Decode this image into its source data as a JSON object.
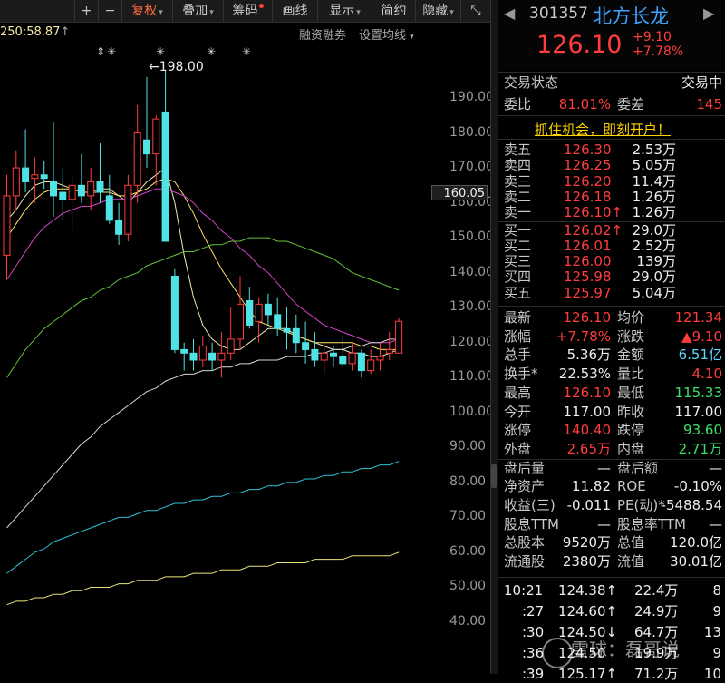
{
  "toolbar": {
    "buttons": [
      {
        "label": "+"
      },
      {
        "label": "−"
      },
      {
        "label": "复权",
        "caret": "▾",
        "active": true
      },
      {
        "label": "叠加",
        "caret": "▾"
      },
      {
        "label": "筹码"
      },
      {
        "label": "画线"
      },
      {
        "label": "显示",
        "caret": "▾"
      },
      {
        "label": "简约"
      },
      {
        "label": "隐藏",
        "caret": "▾"
      },
      {
        "label": "⤡"
      }
    ]
  },
  "subbar": {
    "ma250": "250:58.87",
    "ma250_arrow": "↑",
    "rzrq": "融资融券",
    "setma": "设置均线",
    "caret": "▾"
  },
  "y_axis": {
    "ticks": [
      "190.00",
      "180.00",
      "170.00",
      "160.00",
      "150.00",
      "140.00",
      "130.00",
      "120.00",
      "110.00",
      "100.00",
      "90.00",
      "80.00",
      "70.00",
      "60.00",
      "50.00",
      "40.00"
    ],
    "current": "160.05"
  },
  "high_label": "198.00",
  "event_markers": [
    "⇕",
    "✳",
    "✳",
    "✳",
    "✳",
    "⇕"
  ],
  "chart_data": {
    "type": "candlestick",
    "ylim": [
      35,
      200
    ],
    "candles": [
      {
        "o": 145,
        "h": 168,
        "l": 138,
        "c": 162
      },
      {
        "o": 162,
        "h": 175,
        "l": 158,
        "c": 170
      },
      {
        "o": 170,
        "h": 181,
        "l": 163,
        "c": 166
      },
      {
        "o": 167,
        "h": 173,
        "l": 160,
        "c": 168
      },
      {
        "o": 168,
        "h": 172,
        "l": 164,
        "c": 167
      },
      {
        "o": 166,
        "h": 183,
        "l": 156,
        "c": 162
      },
      {
        "o": 163,
        "h": 170,
        "l": 155,
        "c": 161
      },
      {
        "o": 161,
        "h": 168,
        "l": 152,
        "c": 165
      },
      {
        "o": 165,
        "h": 174,
        "l": 160,
        "c": 162
      },
      {
        "o": 162,
        "h": 170,
        "l": 158,
        "c": 166
      },
      {
        "o": 166,
        "h": 177,
        "l": 160,
        "c": 163
      },
      {
        "o": 162,
        "h": 168,
        "l": 154,
        "c": 155
      },
      {
        "o": 155,
        "h": 160,
        "l": 148,
        "c": 151
      },
      {
        "o": 151,
        "h": 168,
        "l": 149,
        "c": 165
      },
      {
        "o": 165,
        "h": 188,
        "l": 160,
        "c": 180
      },
      {
        "o": 178,
        "h": 196,
        "l": 170,
        "c": 174
      },
      {
        "o": 174,
        "h": 185,
        "l": 165,
        "c": 184
      },
      {
        "o": 186,
        "h": 198,
        "l": 149,
        "c": 149
      },
      {
        "o": 139,
        "h": 141,
        "l": 117,
        "c": 118
      },
      {
        "o": 118,
        "h": 120,
        "l": 112,
        "c": 117
      },
      {
        "o": 117,
        "h": 121,
        "l": 112,
        "c": 115
      },
      {
        "o": 115,
        "h": 122,
        "l": 113,
        "c": 119
      },
      {
        "o": 117,
        "h": 120,
        "l": 112,
        "c": 115
      },
      {
        "o": 115,
        "h": 123,
        "l": 110,
        "c": 117
      },
      {
        "o": 117,
        "h": 130,
        "l": 115,
        "c": 121
      },
      {
        "o": 121,
        "h": 139,
        "l": 118,
        "c": 131
      },
      {
        "o": 132,
        "h": 136,
        "l": 124,
        "c": 125
      },
      {
        "o": 126,
        "h": 133,
        "l": 120,
        "c": 131
      },
      {
        "o": 131,
        "h": 134,
        "l": 125,
        "c": 128
      },
      {
        "o": 128,
        "h": 133,
        "l": 122,
        "c": 124
      },
      {
        "o": 124,
        "h": 130,
        "l": 118,
        "c": 123
      },
      {
        "o": 124,
        "h": 128,
        "l": 117,
        "c": 120
      },
      {
        "o": 120,
        "h": 126,
        "l": 114,
        "c": 118
      },
      {
        "o": 118,
        "h": 123,
        "l": 113,
        "c": 115
      },
      {
        "o": 115,
        "h": 120,
        "l": 111,
        "c": 117
      },
      {
        "o": 117,
        "h": 119,
        "l": 113,
        "c": 116
      },
      {
        "o": 116,
        "h": 122,
        "l": 113,
        "c": 114
      },
      {
        "o": 114,
        "h": 120,
        "l": 112,
        "c": 117
      },
      {
        "o": 117,
        "h": 118,
        "l": 110,
        "c": 112
      },
      {
        "o": 112,
        "h": 118,
        "l": 111,
        "c": 115
      },
      {
        "o": 115,
        "h": 120,
        "l": 112,
        "c": 116
      },
      {
        "o": 117,
        "h": 123,
        "l": 115,
        "c": 118
      },
      {
        "o": 117,
        "h": 127,
        "l": 117,
        "c": 126.1
      }
    ],
    "ma_lines": [
      {
        "color": "#f1e9b3",
        "values": [
          155,
          158,
          162,
          165,
          166,
          166,
          165,
          164,
          163,
          163,
          164,
          164,
          162,
          160,
          163,
          166,
          168,
          170,
          160,
          145,
          133,
          125,
          121,
          119,
          118,
          118,
          120,
          122,
          124,
          124,
          124,
          122,
          121,
          120,
          119,
          118,
          118,
          117,
          117,
          116,
          116,
          117,
          118
        ]
      },
      {
        "color": "#ffe36a",
        "values": [
          150,
          154,
          158,
          161,
          163,
          164,
          164,
          164,
          163,
          163,
          163,
          163,
          162,
          162,
          163,
          164,
          166,
          167,
          166,
          162,
          157,
          151,
          146,
          141,
          137,
          133,
          129,
          126,
          125,
          124,
          123,
          122,
          121,
          120,
          120,
          120,
          120,
          120,
          119,
          119,
          118,
          118,
          118
        ]
      },
      {
        "color": "#d444c8",
        "values": [
          138,
          142,
          146,
          150,
          153,
          155,
          157,
          158,
          159,
          159,
          160,
          161,
          161,
          161,
          162,
          163,
          164,
          164,
          163,
          162,
          160,
          157,
          155,
          152,
          150,
          147,
          145,
          142,
          140,
          137,
          134,
          131,
          129,
          127,
          125,
          124,
          123,
          122,
          121,
          120,
          120,
          120,
          121
        ]
      },
      {
        "color": "#63c23c",
        "values": [
          110,
          114,
          118,
          121,
          124,
          126,
          128,
          130,
          132,
          133,
          135,
          136,
          138,
          139,
          140,
          142,
          143,
          144,
          145,
          146,
          146,
          147,
          148,
          148,
          149,
          149,
          150,
          150,
          150,
          149,
          149,
          148,
          147,
          146,
          145,
          144,
          142,
          140,
          139,
          138,
          137,
          136,
          135
        ]
      },
      {
        "color": "#d7d7d7",
        "values": [
          67,
          70,
          73,
          76,
          79,
          82,
          85,
          88,
          91,
          93,
          96,
          98,
          100,
          102,
          104,
          106,
          107,
          109,
          110,
          111,
          111,
          112,
          112,
          113,
          113,
          114,
          114,
          115,
          115,
          115,
          116,
          116,
          116,
          117,
          117,
          118,
          118,
          119,
          119,
          120,
          120,
          121,
          121
        ]
      },
      {
        "color": "#2ec2d6",
        "values": [
          54,
          56,
          58,
          60,
          61,
          63,
          64,
          65,
          66,
          67,
          68,
          69,
          70,
          70,
          71,
          72,
          72,
          73,
          74,
          74,
          75,
          75,
          76,
          76,
          77,
          77,
          78,
          78,
          79,
          79,
          80,
          80,
          81,
          81,
          82,
          82,
          83,
          83,
          84,
          84,
          85,
          85,
          86
        ]
      },
      {
        "color": "#e8e27c",
        "values": [
          45,
          46,
          46,
          47,
          47,
          48,
          48,
          49,
          49,
          50,
          50,
          50,
          51,
          51,
          52,
          52,
          52,
          53,
          53,
          53,
          54,
          54,
          54,
          55,
          55,
          55,
          56,
          56,
          56,
          57,
          57,
          57,
          57,
          58,
          58,
          58,
          58,
          59,
          59,
          59,
          59,
          59,
          60
        ]
      }
    ]
  },
  "quote": {
    "nav_left": "◀",
    "nav_right": "▶",
    "code": "301357",
    "name": "北方长龙",
    "price": "126.10",
    "change": "+9.10",
    "change_pct": "+7.78%",
    "status_label": "交易状态",
    "status_value": "交易中",
    "weibi_label": "委比",
    "weibi": "81.01%",
    "weicha_label": "委差",
    "weicha": "145",
    "promo": "抓住机会，即刻开户！"
  },
  "order_book": {
    "asks": [
      {
        "label": "卖五",
        "price": "126.30",
        "vol": "2.53万"
      },
      {
        "label": "卖四",
        "price": "126.25",
        "vol": "5.05万"
      },
      {
        "label": "卖三",
        "price": "126.20",
        "vol": "11.4万"
      },
      {
        "label": "卖二",
        "price": "126.18",
        "vol": "1.26万"
      },
      {
        "label": "卖一",
        "price": "126.10↑",
        "vol": "1.26万"
      }
    ],
    "bids": [
      {
        "label": "买一",
        "price": "126.02↑",
        "vol": "29.0万"
      },
      {
        "label": "买二",
        "price": "126.01",
        "vol": "2.52万"
      },
      {
        "label": "买三",
        "price": "126.00",
        "vol": "139万"
      },
      {
        "label": "买四",
        "price": "125.98",
        "vol": "29.0万"
      },
      {
        "label": "买五",
        "price": "125.97",
        "vol": "5.04万"
      }
    ]
  },
  "stats": [
    {
      "l1": "最新",
      "v1": "126.10",
      "c1": "red",
      "l2": "均价",
      "v2": "121.34",
      "c2": "red"
    },
    {
      "l1": "涨幅",
      "v1": "+7.78%",
      "c1": "red",
      "l2": "涨跌",
      "v2": "▲9.10",
      "c2": "red"
    },
    {
      "l1": "总手",
      "v1": "5.36万",
      "c1": "white",
      "l2": "金额",
      "v2": "6.51亿",
      "c2": "cyan"
    },
    {
      "l1": "换手*",
      "v1": "22.53%",
      "c1": "white",
      "l2": "量比",
      "v2": "4.10",
      "c2": "red"
    },
    {
      "l1": "最高",
      "v1": "126.10",
      "c1": "red",
      "l2": "最低",
      "v2": "115.33",
      "c2": "green"
    },
    {
      "l1": "今开",
      "v1": "117.00",
      "c1": "white",
      "l2": "昨收",
      "v2": "117.00",
      "c2": "white"
    },
    {
      "l1": "涨停",
      "v1": "140.40",
      "c1": "red",
      "l2": "跌停",
      "v2": "93.60",
      "c2": "green"
    },
    {
      "l1": "外盘",
      "v1": "2.65万",
      "c1": "red",
      "l2": "内盘",
      "v2": "2.71万",
      "c2": "green"
    },
    {
      "l1": "盘后量",
      "v1": "—",
      "c1": "white",
      "l2": "盘后额",
      "v2": "—",
      "c2": "white"
    },
    {
      "l1": "净资产",
      "v1": "11.82",
      "c1": "white",
      "l2": "ROE",
      "v2": "-0.10%",
      "c2": "white"
    },
    {
      "l1": "收益(三)",
      "v1": "-0.011",
      "c1": "white",
      "l2": "PE(动)*",
      "v2": "-5488.54",
      "c2": "white"
    },
    {
      "l1": "股息TTM",
      "v1": "—",
      "c1": "white",
      "l2": "股息率TTM",
      "v2": "—",
      "c2": "white"
    },
    {
      "l1": "总股本",
      "v1": "9520万",
      "c1": "white",
      "l2": "总值",
      "v2": "120.0亿",
      "c2": "white"
    },
    {
      "l1": "流通股",
      "v1": "2380万",
      "c1": "white",
      "l2": "流值",
      "v2": "30.01亿",
      "c2": "white"
    }
  ],
  "ticks": [
    {
      "time": "10:21",
      "price": "124.38↑",
      "vol": "22.4万",
      "n": "8",
      "dir": "red"
    },
    {
      "time": ":27",
      "price": "124.60↑",
      "vol": "24.9万",
      "n": "9",
      "dir": "red"
    },
    {
      "time": ":30",
      "price": "124.50↓",
      "vol": "64.7万",
      "n": "13",
      "dir": "green"
    },
    {
      "time": ":36",
      "price": "124.50",
      "vol": "19.9万",
      "n": "9",
      "dir": "red"
    },
    {
      "time": ":39",
      "price": "125.17↑",
      "vol": "71.2万",
      "n": "10",
      "dir": "red"
    }
  ],
  "watermark": "雪球：磊哥说"
}
